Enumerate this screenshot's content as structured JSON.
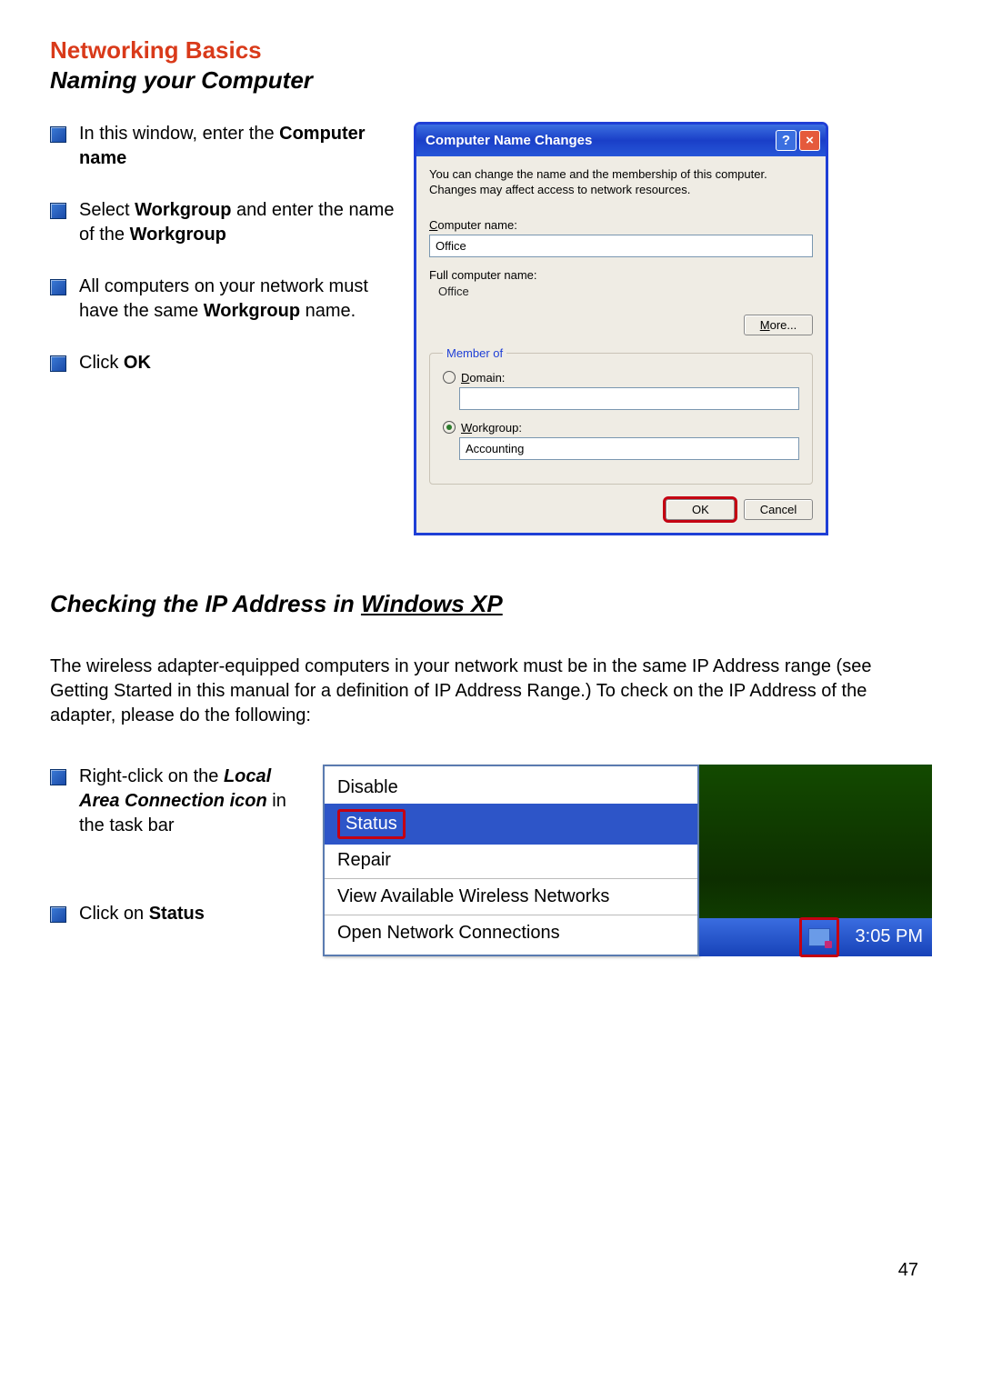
{
  "heading": "Networking Basics",
  "subtitle": "Naming your Computer",
  "bullets1": [
    {
      "pre": "In this window, enter the ",
      "bold": "Computer name",
      "post": ""
    },
    {
      "pre": "Select ",
      "bold": "Workgroup",
      "mid": " and enter the name of the ",
      "bold2": "Workgroup",
      "post": ""
    },
    {
      "pre": "All computers on your network must have the same ",
      "bold": "Workgroup",
      "post": " name."
    },
    {
      "pre": "Click ",
      "bold": "OK",
      "post": ""
    }
  ],
  "dialog": {
    "title": "Computer Name Changes",
    "desc": "You can change the name and the membership of this computer. Changes may affect access to network resources.",
    "label_computer": "Computer name:",
    "value_computer": "Office",
    "label_full": "Full computer name:",
    "value_full": "Office",
    "more": "More...",
    "legend": "Member of",
    "radio_domain": "Domain:",
    "radio_workgroup": "Workgroup:",
    "value_workgroup": "Accounting",
    "ok": "OK",
    "cancel": "Cancel"
  },
  "section2": {
    "title_prefix": "Checking the IP Address in ",
    "title_underline": "Windows XP",
    "body": "The wireless adapter-equipped computers in your network must be in the same IP Address range (see Getting Started in this manual for a definition of IP Address Range.)  To check on the IP Address of the adapter, please do the following:"
  },
  "bullets2": [
    {
      "pre": "Right-click on the ",
      "bolditalic": "Local Area Connection icon",
      "post": " in the task bar"
    },
    {
      "pre": "Click on ",
      "bold": "Status",
      "post": ""
    }
  ],
  "context_menu": {
    "disable": "Disable",
    "status": "Status",
    "repair": "Repair",
    "view": "View Available Wireless Networks",
    "open": "Open Network Connections"
  },
  "clock": "3:05 PM",
  "page_number": "47"
}
